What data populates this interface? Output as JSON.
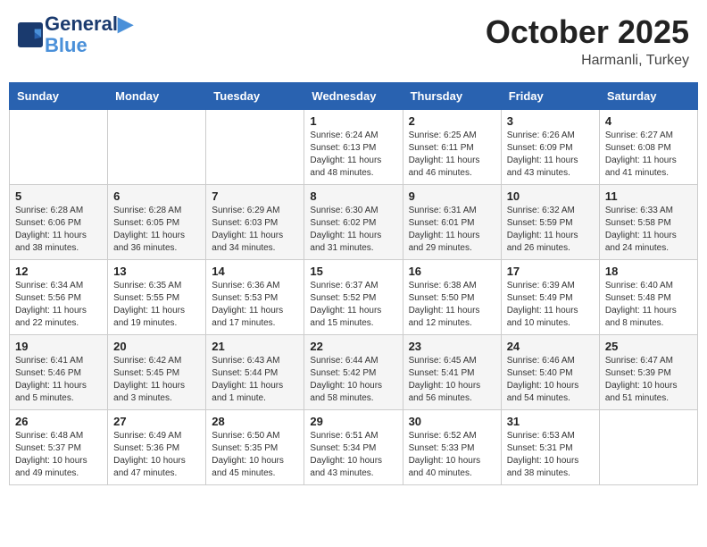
{
  "header": {
    "logo_line1": "General",
    "logo_line2": "Blue",
    "month": "October 2025",
    "location": "Harmanli, Turkey"
  },
  "weekdays": [
    "Sunday",
    "Monday",
    "Tuesday",
    "Wednesday",
    "Thursday",
    "Friday",
    "Saturday"
  ],
  "weeks": [
    [
      {
        "day": "",
        "info": ""
      },
      {
        "day": "",
        "info": ""
      },
      {
        "day": "",
        "info": ""
      },
      {
        "day": "1",
        "info": "Sunrise: 6:24 AM\nSunset: 6:13 PM\nDaylight: 11 hours\nand 48 minutes."
      },
      {
        "day": "2",
        "info": "Sunrise: 6:25 AM\nSunset: 6:11 PM\nDaylight: 11 hours\nand 46 minutes."
      },
      {
        "day": "3",
        "info": "Sunrise: 6:26 AM\nSunset: 6:09 PM\nDaylight: 11 hours\nand 43 minutes."
      },
      {
        "day": "4",
        "info": "Sunrise: 6:27 AM\nSunset: 6:08 PM\nDaylight: 11 hours\nand 41 minutes."
      }
    ],
    [
      {
        "day": "5",
        "info": "Sunrise: 6:28 AM\nSunset: 6:06 PM\nDaylight: 11 hours\nand 38 minutes."
      },
      {
        "day": "6",
        "info": "Sunrise: 6:28 AM\nSunset: 6:05 PM\nDaylight: 11 hours\nand 36 minutes."
      },
      {
        "day": "7",
        "info": "Sunrise: 6:29 AM\nSunset: 6:03 PM\nDaylight: 11 hours\nand 34 minutes."
      },
      {
        "day": "8",
        "info": "Sunrise: 6:30 AM\nSunset: 6:02 PM\nDaylight: 11 hours\nand 31 minutes."
      },
      {
        "day": "9",
        "info": "Sunrise: 6:31 AM\nSunset: 6:01 PM\nDaylight: 11 hours\nand 29 minutes."
      },
      {
        "day": "10",
        "info": "Sunrise: 6:32 AM\nSunset: 5:59 PM\nDaylight: 11 hours\nand 26 minutes."
      },
      {
        "day": "11",
        "info": "Sunrise: 6:33 AM\nSunset: 5:58 PM\nDaylight: 11 hours\nand 24 minutes."
      }
    ],
    [
      {
        "day": "12",
        "info": "Sunrise: 6:34 AM\nSunset: 5:56 PM\nDaylight: 11 hours\nand 22 minutes."
      },
      {
        "day": "13",
        "info": "Sunrise: 6:35 AM\nSunset: 5:55 PM\nDaylight: 11 hours\nand 19 minutes."
      },
      {
        "day": "14",
        "info": "Sunrise: 6:36 AM\nSunset: 5:53 PM\nDaylight: 11 hours\nand 17 minutes."
      },
      {
        "day": "15",
        "info": "Sunrise: 6:37 AM\nSunset: 5:52 PM\nDaylight: 11 hours\nand 15 minutes."
      },
      {
        "day": "16",
        "info": "Sunrise: 6:38 AM\nSunset: 5:50 PM\nDaylight: 11 hours\nand 12 minutes."
      },
      {
        "day": "17",
        "info": "Sunrise: 6:39 AM\nSunset: 5:49 PM\nDaylight: 11 hours\nand 10 minutes."
      },
      {
        "day": "18",
        "info": "Sunrise: 6:40 AM\nSunset: 5:48 PM\nDaylight: 11 hours\nand 8 minutes."
      }
    ],
    [
      {
        "day": "19",
        "info": "Sunrise: 6:41 AM\nSunset: 5:46 PM\nDaylight: 11 hours\nand 5 minutes."
      },
      {
        "day": "20",
        "info": "Sunrise: 6:42 AM\nSunset: 5:45 PM\nDaylight: 11 hours\nand 3 minutes."
      },
      {
        "day": "21",
        "info": "Sunrise: 6:43 AM\nSunset: 5:44 PM\nDaylight: 11 hours\nand 1 minute."
      },
      {
        "day": "22",
        "info": "Sunrise: 6:44 AM\nSunset: 5:42 PM\nDaylight: 10 hours\nand 58 minutes."
      },
      {
        "day": "23",
        "info": "Sunrise: 6:45 AM\nSunset: 5:41 PM\nDaylight: 10 hours\nand 56 minutes."
      },
      {
        "day": "24",
        "info": "Sunrise: 6:46 AM\nSunset: 5:40 PM\nDaylight: 10 hours\nand 54 minutes."
      },
      {
        "day": "25",
        "info": "Sunrise: 6:47 AM\nSunset: 5:39 PM\nDaylight: 10 hours\nand 51 minutes."
      }
    ],
    [
      {
        "day": "26",
        "info": "Sunrise: 6:48 AM\nSunset: 5:37 PM\nDaylight: 10 hours\nand 49 minutes."
      },
      {
        "day": "27",
        "info": "Sunrise: 6:49 AM\nSunset: 5:36 PM\nDaylight: 10 hours\nand 47 minutes."
      },
      {
        "day": "28",
        "info": "Sunrise: 6:50 AM\nSunset: 5:35 PM\nDaylight: 10 hours\nand 45 minutes."
      },
      {
        "day": "29",
        "info": "Sunrise: 6:51 AM\nSunset: 5:34 PM\nDaylight: 10 hours\nand 43 minutes."
      },
      {
        "day": "30",
        "info": "Sunrise: 6:52 AM\nSunset: 5:33 PM\nDaylight: 10 hours\nand 40 minutes."
      },
      {
        "day": "31",
        "info": "Sunrise: 6:53 AM\nSunset: 5:31 PM\nDaylight: 10 hours\nand 38 minutes."
      },
      {
        "day": "",
        "info": ""
      }
    ]
  ]
}
